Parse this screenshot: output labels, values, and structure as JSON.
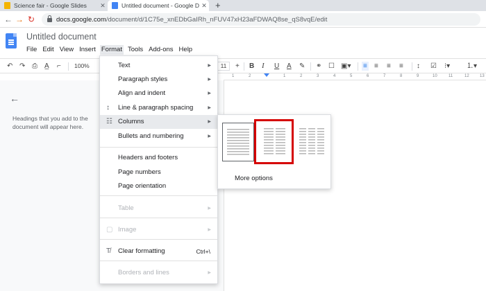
{
  "browser": {
    "tabs": [
      {
        "title": "Science fair - Google Slides",
        "active": false
      },
      {
        "title": "Untitled document - Google Do",
        "active": true
      }
    ],
    "new_tab": "+",
    "url_domain": "docs.google.com",
    "url_path": "/document/d/1C75e_xnEDbGaIRh_nFUV47xH23aFDWAQ8se_qS8vqE/edit"
  },
  "doc": {
    "title": "Untitled document",
    "menus": [
      "File",
      "Edit",
      "View",
      "Insert",
      "Format",
      "Tools",
      "Add-ons",
      "Help"
    ],
    "open_menu": "Format"
  },
  "toolbar": {
    "zoom": "100%",
    "font_size": "11",
    "plus": "+",
    "bold": "B",
    "italic": "I",
    "underline": "U",
    "text_color": "A"
  },
  "ruler": [
    "1",
    "2",
    "1",
    "2",
    "3",
    "4",
    "5",
    "6",
    "7",
    "8",
    "9",
    "10",
    "11",
    "12",
    "13"
  ],
  "outline": {
    "hint": "Headings that you add to the document will appear here."
  },
  "format_menu": {
    "items": [
      {
        "label": "Text",
        "submenu": true
      },
      {
        "label": "Paragraph styles",
        "submenu": true
      },
      {
        "label": "Align and indent",
        "submenu": true
      },
      {
        "label": "Line & paragraph spacing",
        "submenu": true,
        "icon": "line-spacing-icon"
      },
      {
        "label": "Columns",
        "submenu": true,
        "icon": "columns-icon",
        "highlighted": true
      },
      {
        "label": "Bullets and numbering",
        "submenu": true
      },
      {
        "label": "Headers and footers"
      },
      {
        "label": "Page numbers"
      },
      {
        "label": "Page orientation"
      },
      {
        "label": "Table",
        "submenu": true,
        "disabled": true
      },
      {
        "label": "Image",
        "submenu": true,
        "disabled": true,
        "icon": "image-icon"
      },
      {
        "label": "Clear formatting",
        "shortcut": "Ctrl+\\",
        "icon": "clear-formatting-icon"
      },
      {
        "label": "Borders and lines",
        "submenu": true,
        "disabled": true
      }
    ]
  },
  "columns_submenu": {
    "options": [
      "one-column",
      "two-columns",
      "three-columns"
    ],
    "selected": "one-column",
    "highlighted_option": "two-columns",
    "more_options": "More options"
  },
  "colors": {
    "accent": "#4285f4",
    "highlight_box": "#d50000",
    "menu_hover": "#e8eaed"
  }
}
